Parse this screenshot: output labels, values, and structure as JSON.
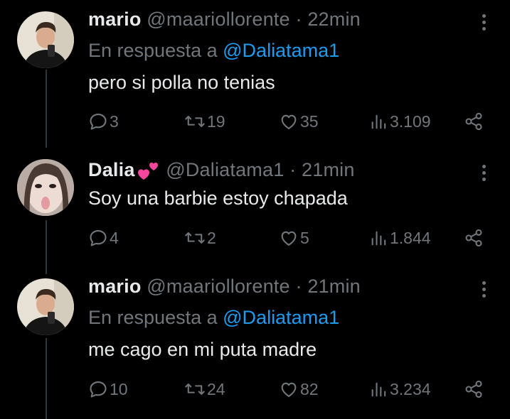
{
  "tweets": [
    {
      "name": "mario",
      "handle": "@maariollorente",
      "time": "· 22min",
      "reply_prefix": "En respuesta a",
      "reply_mention": "@Daliatama1",
      "text": "pero si polla no tenias",
      "stats": {
        "replies": "3",
        "retweets": "19",
        "likes": "35",
        "views": "3.109"
      }
    },
    {
      "name": "Dalia",
      "name_emoji": "revolving-hearts-icon",
      "handle": "@Daliatama1",
      "time": "· 21min",
      "text": "Soy una barbie estoy chapada",
      "stats": {
        "replies": "4",
        "retweets": "2",
        "likes": "5",
        "views": "1.844"
      }
    },
    {
      "name": "mario",
      "handle": "@maariollorente",
      "time": "· 21min",
      "reply_prefix": "En respuesta a",
      "reply_mention": "@Daliatama1",
      "text": "me cago en mi puta madre",
      "stats": {
        "replies": "10",
        "retweets": "24",
        "likes": "82",
        "views": "3.234"
      }
    }
  ],
  "colors": {
    "background": "#000000",
    "text": "#e7e9ea",
    "muted": "#71767b",
    "link": "#1d9bf0",
    "line": "#333639"
  }
}
